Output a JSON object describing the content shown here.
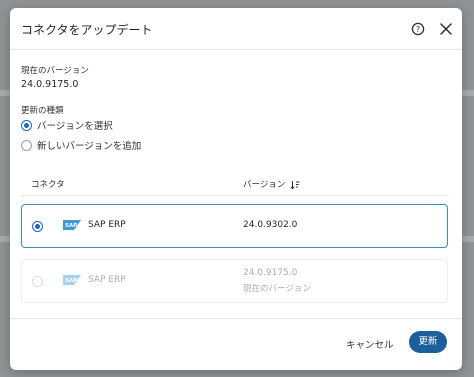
{
  "dialog": {
    "title": "コネクタをアップデート",
    "current_version_label": "現在のバージョン",
    "current_version_value": "24.0.9175.0",
    "update_type_label": "更新の種類",
    "options": [
      {
        "label": "バージョンを選択",
        "selected": true
      },
      {
        "label": "新しいバージョンを追加",
        "selected": false
      }
    ]
  },
  "table": {
    "columns": [
      "コネクタ",
      "バージョン"
    ],
    "rows": [
      {
        "name": "SAP ERP",
        "version": "24.0.9302.0",
        "sub": "",
        "selected": true,
        "disabled": false
      },
      {
        "name": "SAP ERP",
        "version": "24.0.9175.0",
        "sub": "現在のバージョン",
        "selected": false,
        "disabled": true
      }
    ]
  },
  "footer": {
    "cancel_label": "キャンセル",
    "update_label": "更新"
  },
  "logo_text": "SAP",
  "colors": {
    "accent": "#1d63c9",
    "primary_button": "#1c5f9a",
    "selected_border": "#3b8fb2"
  }
}
